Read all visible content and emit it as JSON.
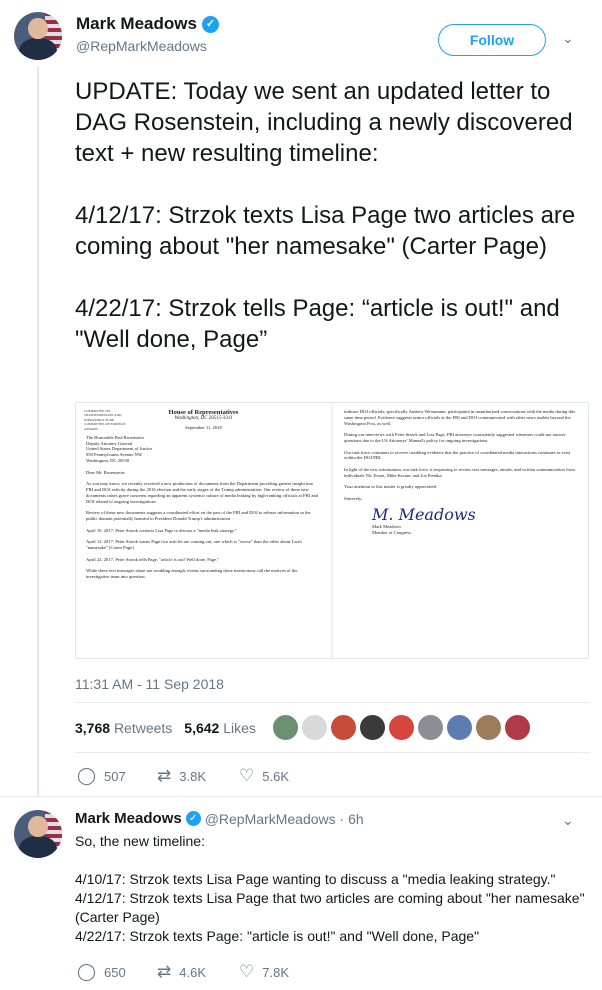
{
  "tweet": {
    "author_name": "Mark Meadows",
    "handle": "@RepMarkMeadows",
    "follow_label": "Follow",
    "text": "UPDATE: Today we sent an updated letter to DAG Rosenstein, including a newly discovered text + new resulting timeline:\n\n4/12/17: Strzok texts Lisa Page two articles are coming about \"her namesake\" (Carter Page)\n\n4/22/17: Strzok tells Page: “article is out!\" and \"Well done, Page”",
    "timestamp": "11:31 AM - 11 Sep 2018",
    "retweets_count": "3,768",
    "retweets_label": "Retweets",
    "likes_count": "5,642",
    "likes_label": "Likes",
    "replies": "507",
    "retweets_short": "3.8K",
    "likes_short": "5.6K",
    "liker_colors": [
      "#6b8f71",
      "#d9d9d9",
      "#c84b3a",
      "#3a3a3a",
      "#d8453c",
      "#8a8f96",
      "#5b7db1",
      "#9a7c5a",
      "#b23a48"
    ]
  },
  "letter": {
    "committees": "COMMITTEE ON TRANSPORTATION AND INFRASTRUCTURE\nCOMMITTEE ON FOREIGN AFFAIRS",
    "house_title": "House of Representatives",
    "house_sub": "Washington, DC 20515-3311",
    "date": "September 11, 2018",
    "left_body": "The Honorable Rod Rosenstein\nDeputy Attorney General\nUnited States Department of Justice\n950 Pennsylvania Avenue NW\nWashington, DC 20530\n\nDear Mr. Rosenstein:\n\nAs you may know, we recently received a new production of documents from the Department providing greater insight into FBI and DOJ activity during the 2016 election and the early stages of the Trump administration. Our review of these new documents raises grave concerns regarding an apparent systemic culture of media leaking by high-ranking officials at FBI and DOJ related to ongoing investigations.\n\nReview of these new documents suggests a coordinated effort on the part of the FBI and DOJ to release information in the public domain potentially harmful to President Donald Trump's administration.\n\nApril 10, 2017: Peter Strzok contacts Lisa Page to discuss a \"media leak strategy.\"\n\nApril 12, 2017: Peter Strzok warns Page two articles are coming out, one which is \"worse\" than the other about Lisa's \"namesake\" [Carter Page].\n\nApril 22, 2017: Peter Strzok tells Page, \"article is out! Well done, Page.\"\n\nWhile these text messages alone are troubling enough, events surrounding these interactions call the motives of the investigative team into question.",
    "right_body": "indicate DOJ officials, specifically Andrew Weissmann, participated in unauthorized conversations with the media during this same time period. Evidence suggests senior officials at the FBI and DOJ communicated with other news outlets beyond the Washington Post, as well.\n\nDuring our interviews with Peter Strzok and Lisa Page, FBI attorneys consistently suggested witnesses could not answer questions due to the US Attorneys' Manual's policy for ongoing investigations.\n\nOur task force continues to receive troubling evidence that the practice of coordinated media interactions continues to exist within the DOJ/FBI.\n\nIn light of the new information, our task force is requesting to review text messages, emails, and written communication from individuals Nic Evans, Mike Kortan, and Joe Pientka.\n\nYour attention to this matter is greatly appreciated.\n\nSincerely,",
    "signer": "Mark Meadows\nMember of Congress"
  },
  "reply": {
    "author_name": "Mark Meadows",
    "meta": "@RepMarkMeadows · 6h",
    "text": "So, the new timeline:\n\n4/10/17: Strzok texts Lisa Page wanting to discuss a \"media leaking strategy.\"\n4/12/17: Strzok texts Lisa Page that two articles are coming about \"her namesake\" (Carter Page)\n4/22/17: Strzok texts Page: \"article is out!\" and \"Well done, Page\"",
    "replies": "650",
    "retweets": "4.6K",
    "likes": "7.8K"
  },
  "colors": {
    "accent": "#1da1f2",
    "muted": "#657786",
    "text": "#14171a"
  }
}
